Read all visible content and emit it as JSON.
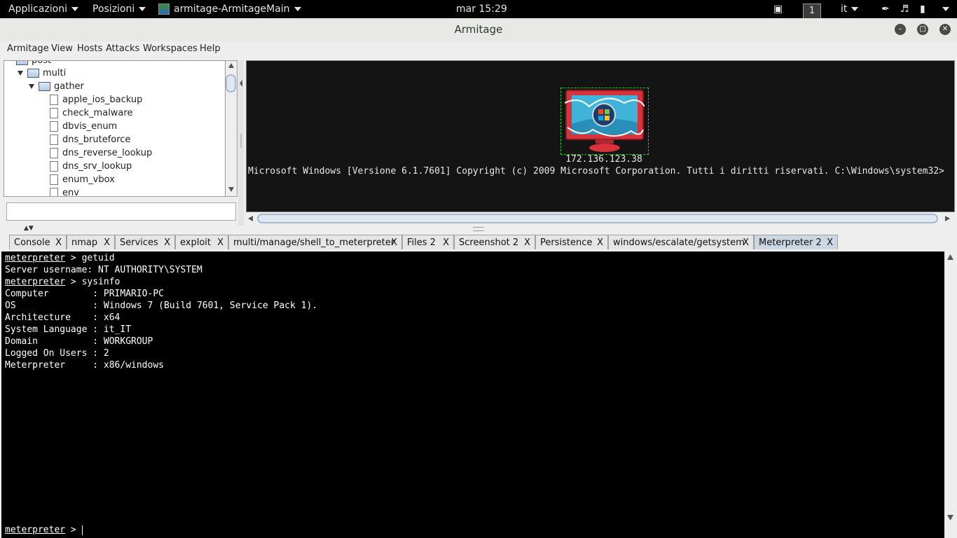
{
  "topbar": {
    "applications": "Applicazioni",
    "places": "Posizioni",
    "app_name": "armitage-ArmitageMain",
    "clock": "mar 15:29",
    "workspace": "1",
    "language": "it"
  },
  "window": {
    "title": "Armitage"
  },
  "menubar": [
    "Armitage",
    "View",
    "Hosts",
    "Attacks",
    "Workspaces",
    "Help"
  ],
  "tree": {
    "top_partial": "post",
    "folders": [
      "multi",
      "gather"
    ],
    "modules": [
      "apple_ios_backup",
      "check_malware",
      "dbvis_enum",
      "dns_bruteforce",
      "dns_reverse_lookup",
      "dns_srv_lookup",
      "enum_vbox",
      "env"
    ]
  },
  "search": {
    "value": ""
  },
  "graph": {
    "host_ip": "172.136.123.38",
    "host_label": "Microsoft Windows [Versione 6.1.7601] Copyright (c) 2009 Microsoft Corporation. Tutti i diritti riservati. C:\\Windows\\system32>"
  },
  "tabs": [
    {
      "label": "Console",
      "close": "X"
    },
    {
      "label": "nmap",
      "close": "X"
    },
    {
      "label": "Services",
      "close": "X"
    },
    {
      "label": "exploit",
      "close": "X"
    },
    {
      "label": "multi/manage/shell_to_meterpreter",
      "close": "X"
    },
    {
      "label": "Files 2",
      "close": "X"
    },
    {
      "label": "Screenshot 2",
      "close": "X"
    },
    {
      "label": "Persistence",
      "close": "X"
    },
    {
      "label": "windows/escalate/getsystem",
      "close": "X"
    },
    {
      "label": "Meterpreter 2",
      "close": "X"
    }
  ],
  "console": {
    "prompt_word": "meterpreter",
    "cmd1": " > getuid",
    "server_user": "Server username: NT AUTHORITY\\SYSTEM",
    "cmd2": " > sysinfo",
    "sysinfo": [
      {
        "key": "Computer        : ",
        "value": "PRIMARIO-PC"
      },
      {
        "key": "OS              : ",
        "value": "Windows 7 (Build 7601, Service Pack 1)."
      },
      {
        "key": "Architecture    : ",
        "value": "x64"
      },
      {
        "key": "System Language : ",
        "value": "it_IT"
      },
      {
        "key": "Domain          : ",
        "value": "WORKGROUP"
      },
      {
        "key": "Logged On Users : ",
        "value": "2"
      },
      {
        "key": "Meterpreter     : ",
        "value": "x86/windows"
      }
    ],
    "input_prompt": " > "
  }
}
